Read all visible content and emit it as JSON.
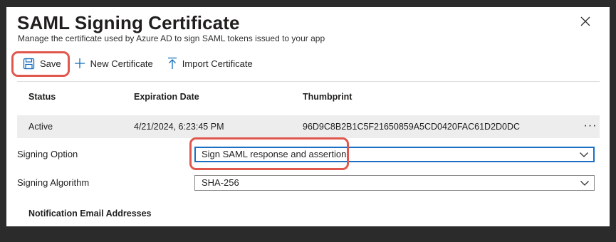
{
  "panel": {
    "title": "SAML Signing Certificate",
    "subtitle": "Manage the certificate used by Azure AD to sign SAML tokens issued to your app"
  },
  "toolbar": {
    "save_label": "Save",
    "new_cert_label": "New Certificate",
    "import_cert_label": "Import Certificate"
  },
  "table": {
    "headers": [
      "Status",
      "Expiration Date",
      "Thumbprint"
    ],
    "rows": [
      [
        "Active",
        "4/21/2024, 6:23:45 PM",
        "96D9C8B2B1C5F21650859A5CD0420FAC61D2D0DC"
      ]
    ],
    "more_label": "···"
  },
  "form": {
    "signing_option_label": "Signing Option",
    "signing_option_value": "Sign SAML response and assertion",
    "signing_algorithm_label": "Signing Algorithm",
    "signing_algorithm_value": "SHA-256",
    "notification_label": "Notification Email Addresses"
  },
  "colors": {
    "highlight": "#e0584d",
    "focus": "#1a6fc4",
    "accent": "#0f6cbd"
  },
  "icons": [
    "close-icon",
    "save-icon",
    "plus-icon",
    "import-icon",
    "more-icon",
    "chevron-down-icon"
  ]
}
